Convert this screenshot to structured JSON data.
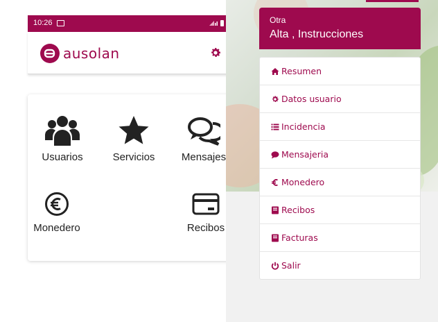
{
  "status_bar": {
    "time": "10:26"
  },
  "app_bar": {
    "brand": "ausolan"
  },
  "tiles": [
    {
      "label": "Usuarios",
      "icon": "users-icon"
    },
    {
      "label": "Servicios",
      "icon": "star-icon"
    },
    {
      "label": "Mensajes",
      "icon": "comments-icon"
    },
    {
      "label": "Monedero",
      "icon": "euro-icon"
    },
    {
      "label": "Recibos",
      "icon": "credit-card-icon"
    }
  ],
  "menu_header": {
    "subtitle": "Otra",
    "title": "Alta , Instrucciones"
  },
  "menu": [
    {
      "label": "Resumen",
      "icon": "home-icon"
    },
    {
      "label": "Datos usuario",
      "icon": "gear-icon"
    },
    {
      "label": "Incidencia",
      "icon": "list-icon"
    },
    {
      "label": "Mensajeria",
      "icon": "comment-icon"
    },
    {
      "label": "Monedero",
      "icon": "euro-sign-icon"
    },
    {
      "label": "Recibos",
      "icon": "book-icon"
    },
    {
      "label": "Facturas",
      "icon": "book-icon"
    },
    {
      "label": "Salir",
      "icon": "power-icon"
    }
  ],
  "colors": {
    "brand": "#9e0a4e",
    "text": "#222222"
  }
}
